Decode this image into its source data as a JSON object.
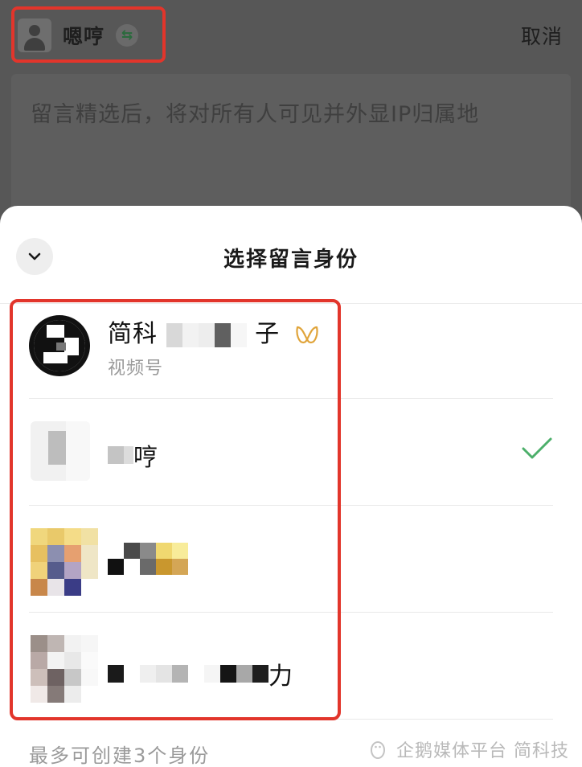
{
  "header": {
    "current_identity": "嗯哼",
    "cancel_label": "取消"
  },
  "composer": {
    "placeholder": "留言精选后，将对所有人可见并外显IP归属地"
  },
  "sheet": {
    "title": "选择留言身份",
    "accounts": [
      {
        "name_visible_prefix": "简科",
        "name_visible_suffix": "子",
        "type_label": "视频号",
        "badge_icon": "channels-icon",
        "selected": false
      },
      {
        "name_visible_suffix": "哼",
        "selected": true
      },
      {
        "name_visible_suffix": "",
        "selected": false
      },
      {
        "name_visible_suffix": "力",
        "selected": false
      }
    ],
    "footer_note": "最多可创建3个身份"
  },
  "watermark": "企鹅媒体平台 简科技",
  "colors": {
    "highlight": "#e2352b",
    "check": "#07c160",
    "channel_badge": "#e0a43a"
  }
}
